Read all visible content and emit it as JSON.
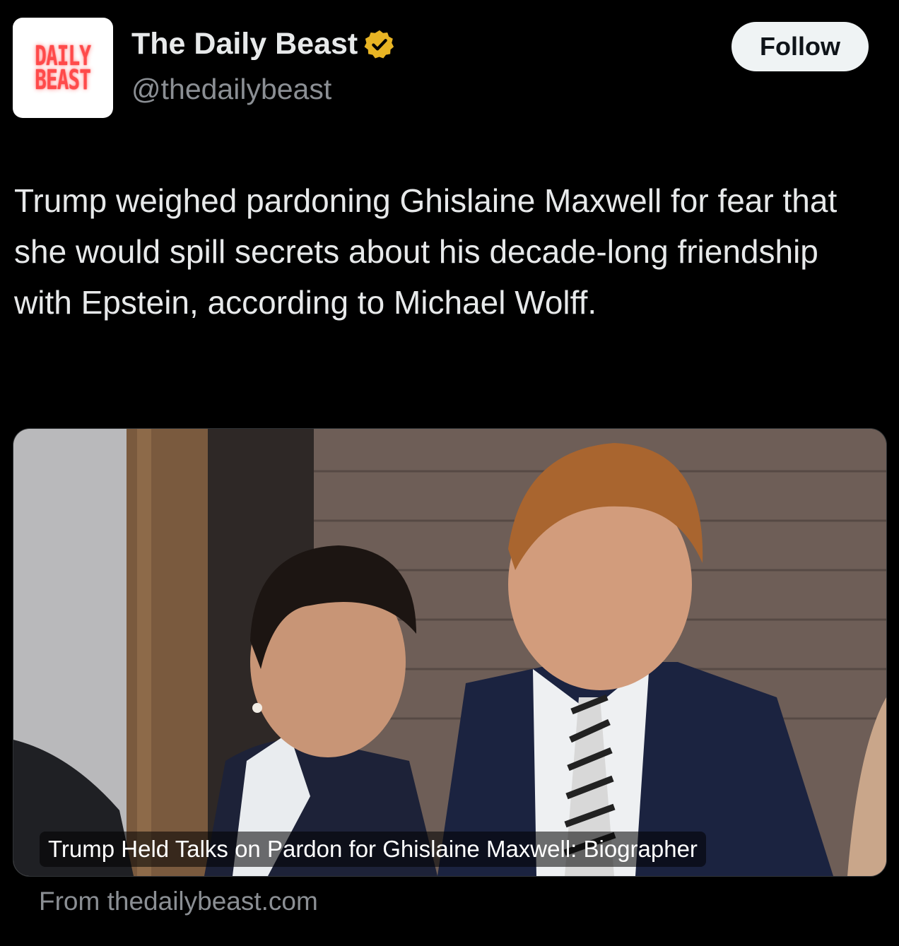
{
  "account": {
    "logo_line1": "DAILY",
    "logo_line2": "BEAST",
    "display_name": "The Daily Beast",
    "handle": "@thedailybeast",
    "verified_badge_color": "#e8b424"
  },
  "follow_button": {
    "label": "Follow"
  },
  "tweet": {
    "text": "Trump weighed pardoning Ghislaine Maxwell for fear that she would spill secrets about his decade-long friendship with Epstein, according to Michael Wolff."
  },
  "link_card": {
    "caption": "Trump Held Talks on Pardon for Ghislaine Maxwell: Biographer",
    "source": "From thedailybeast.com"
  },
  "colors": {
    "background": "#000000",
    "text": "#e7e9ea",
    "secondary_text": "#8b8f94",
    "logo_red": "#ff4a4a"
  }
}
